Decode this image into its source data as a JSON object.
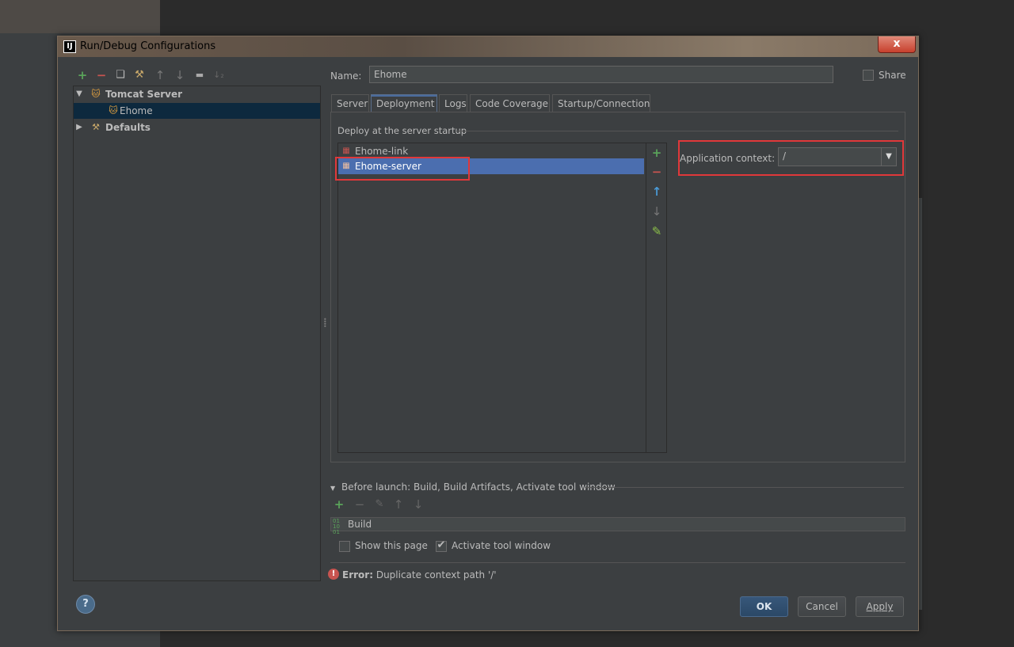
{
  "dialog": {
    "title": "Run/Debug Configurations",
    "title_icon": "IJ",
    "close_label": "x"
  },
  "left_toolbar": {
    "add": "+",
    "remove": "−",
    "copy": "❑",
    "edit_defaults": "⚒",
    "move_up": "↑",
    "move_down": "↓",
    "folder": "▬",
    "sort": "↓₂"
  },
  "tree": {
    "items": [
      {
        "label": "Tomcat Server",
        "arrow": "▼",
        "icon": "tomcat-icon",
        "bold": true
      },
      {
        "label": "Ehome",
        "icon": "tomcat-icon",
        "selected": true
      },
      {
        "label": "Defaults",
        "arrow": "▶",
        "icon": "wrench-icon",
        "bold": true
      }
    ]
  },
  "name": {
    "label": "Name:",
    "value": "Ehome"
  },
  "share": {
    "label": "Share",
    "checked": false
  },
  "tabs": [
    {
      "label": "Server"
    },
    {
      "label": "Deployment",
      "active": true
    },
    {
      "label": "Logs"
    },
    {
      "label": "Code Coverage"
    },
    {
      "label": "Startup/Connection"
    }
  ],
  "deployment": {
    "group_title": "Deploy at the server startup",
    "artifacts": [
      {
        "label": "Ehome-link",
        "selected": false
      },
      {
        "label": "Ehome-server",
        "selected": true
      }
    ],
    "side_buttons": {
      "add": "+",
      "remove": "−",
      "up": "↑",
      "down": "↓",
      "edit": "✎"
    },
    "app_context": {
      "label": "Application context:",
      "value": "/"
    }
  },
  "before_launch": {
    "title": "Before launch: Build, Build Artifacts, Activate tool window",
    "toolbar": {
      "add": "+",
      "remove": "−",
      "edit": "✎",
      "up": "↑",
      "down": "↓"
    },
    "tasks": [
      {
        "label": "Build",
        "icon_text": "01\n10\n01"
      }
    ]
  },
  "options": {
    "show_page": {
      "label": "Show this page",
      "checked": false
    },
    "activate_tool": {
      "label": "Activate tool window",
      "checked": true,
      "mark": "✔"
    }
  },
  "error": {
    "prefix": "Error:",
    "message": "Duplicate context path '/'",
    "icon": "!"
  },
  "buttons": {
    "help": "?",
    "ok": "OK",
    "cancel": "Cancel",
    "apply": "Apply"
  },
  "colors": {
    "selection": "#4b6eaf",
    "tree_selection": "#0d293e",
    "highlight_box": "#e0383a",
    "add_green": "#5aa35a",
    "remove_red": "#c75450"
  }
}
